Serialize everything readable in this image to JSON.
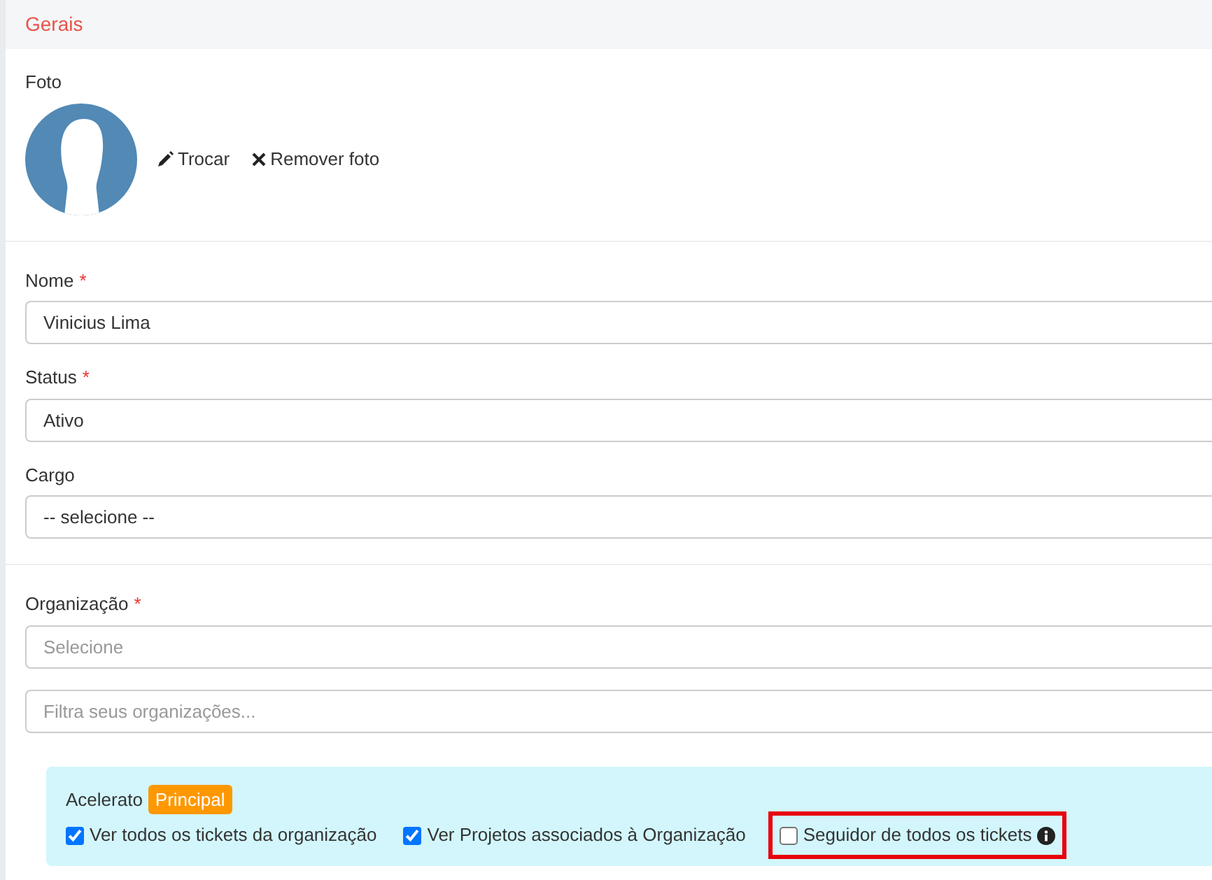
{
  "section": {
    "title": "Gerais"
  },
  "photo": {
    "label": "Foto",
    "actions": [
      {
        "kind": "edit",
        "label": "Trocar"
      },
      {
        "kind": "remove",
        "label": "Remover foto"
      }
    ]
  },
  "fields": [
    {
      "label": "Nome",
      "required_mark": "*",
      "value": "Vinicius Lima"
    },
    {
      "label": "Status",
      "required_mark": "*",
      "value": "Ativo"
    },
    {
      "label": "Cargo",
      "value": "-- selecione --"
    }
  ],
  "organization": {
    "label": "Organização",
    "required_mark": "*",
    "select_placeholder": "Selecione",
    "filter_placeholder": "Filtra seus organizações...",
    "entry": {
      "name": "Acelerato",
      "badge": "Principal",
      "options": [
        {
          "label": "Ver todos os tickets da organização",
          "checked": true,
          "highlighted": false,
          "info": false
        },
        {
          "label": "Ver Projetos associados à Organização",
          "checked": true,
          "highlighted": false,
          "info": false
        },
        {
          "label": "Seguidor de todos os tickets",
          "checked": false,
          "highlighted": true,
          "info": true
        }
      ]
    }
  }
}
